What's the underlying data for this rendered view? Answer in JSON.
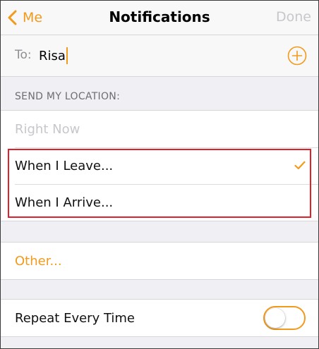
{
  "nav": {
    "back_label": "Me",
    "title": "Notifications",
    "done_label": "Done"
  },
  "to_row": {
    "label": "To:",
    "value": "Risa"
  },
  "section": {
    "header": "SEND MY LOCATION:"
  },
  "location_options": [
    {
      "label": "Right Now",
      "state": "disabled"
    },
    {
      "label": "When I Leave...",
      "state": "selected"
    },
    {
      "label": "When I Arrive...",
      "state": "enabled"
    }
  ],
  "other": {
    "label": "Other..."
  },
  "repeat": {
    "label": "Repeat Every Time",
    "enabled": false
  },
  "icons": {
    "back": "chevron-left-icon",
    "add": "plus-circle-icon",
    "check": "checkmark-icon"
  },
  "colors": {
    "accent": "#f29a1b",
    "disabled_text": "#c7c7cc",
    "highlight_box": "#e0202b",
    "background": "#efeff4"
  }
}
